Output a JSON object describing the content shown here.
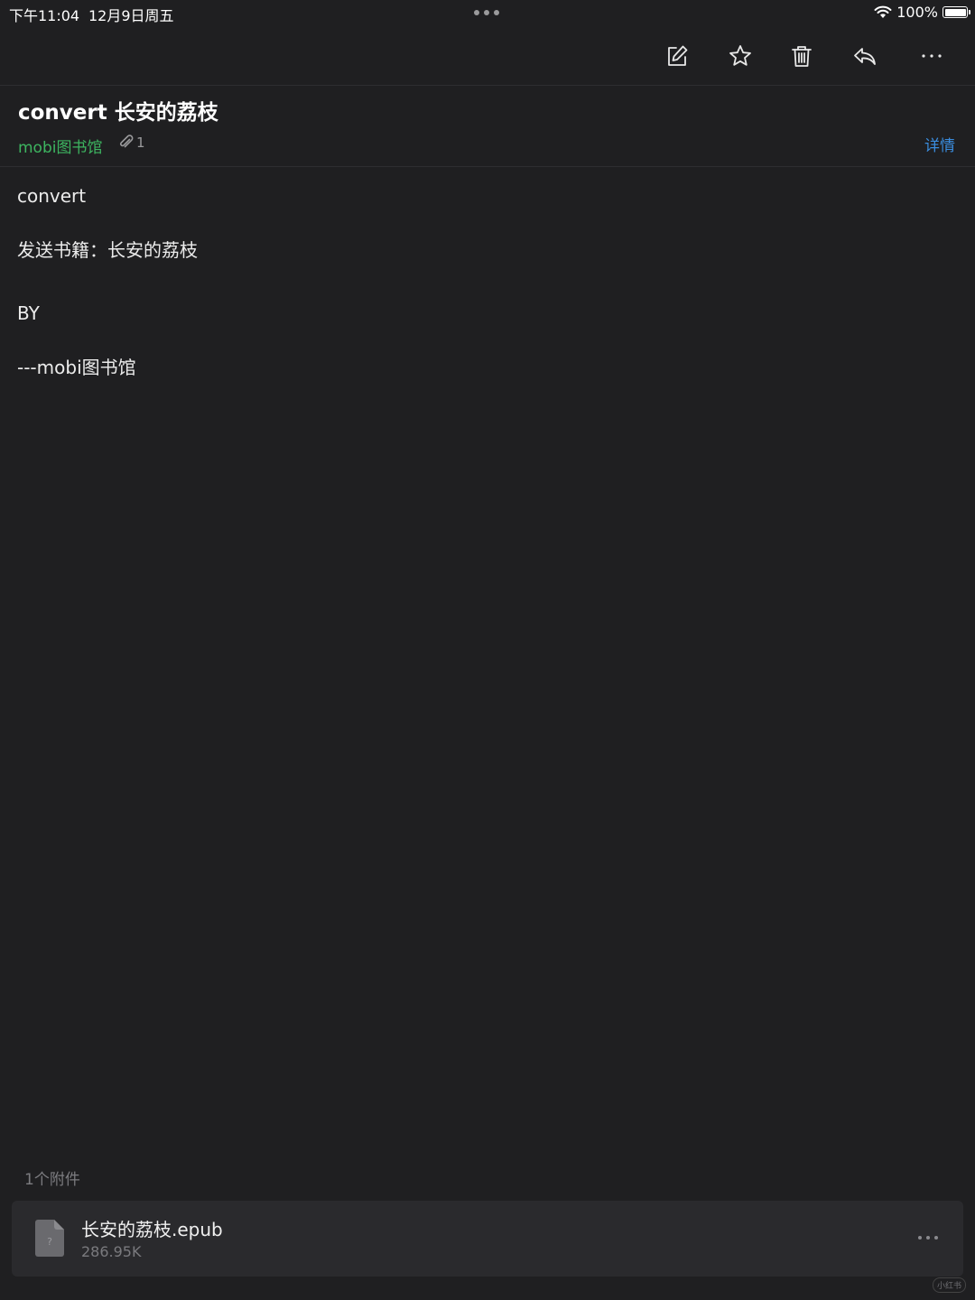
{
  "status_bar": {
    "time": "下午11:04",
    "date": "12月9日周五",
    "battery": "100%"
  },
  "toolbar": {
    "icons": [
      "compose-icon",
      "star-icon",
      "trash-icon",
      "reply-icon",
      "more-icon"
    ]
  },
  "mail": {
    "subject": "convert 长安的荔枝",
    "sender": "mobi图书馆",
    "attachment_count": "1",
    "details_label": "详情",
    "body_lines": [
      "convert",
      "发送书籍：长安的荔枝",
      "BY",
      "---mobi图书馆"
    ]
  },
  "attachments": {
    "header": "1个附件",
    "items": [
      {
        "name": "长安的荔枝.epub",
        "size": "286.95K",
        "icon_glyph": "?"
      }
    ]
  },
  "watermark": "小红书",
  "colors": {
    "background": "#1f1f21",
    "sender": "#3db560",
    "link": "#3a8ddf",
    "card": "#2a2a2d"
  }
}
